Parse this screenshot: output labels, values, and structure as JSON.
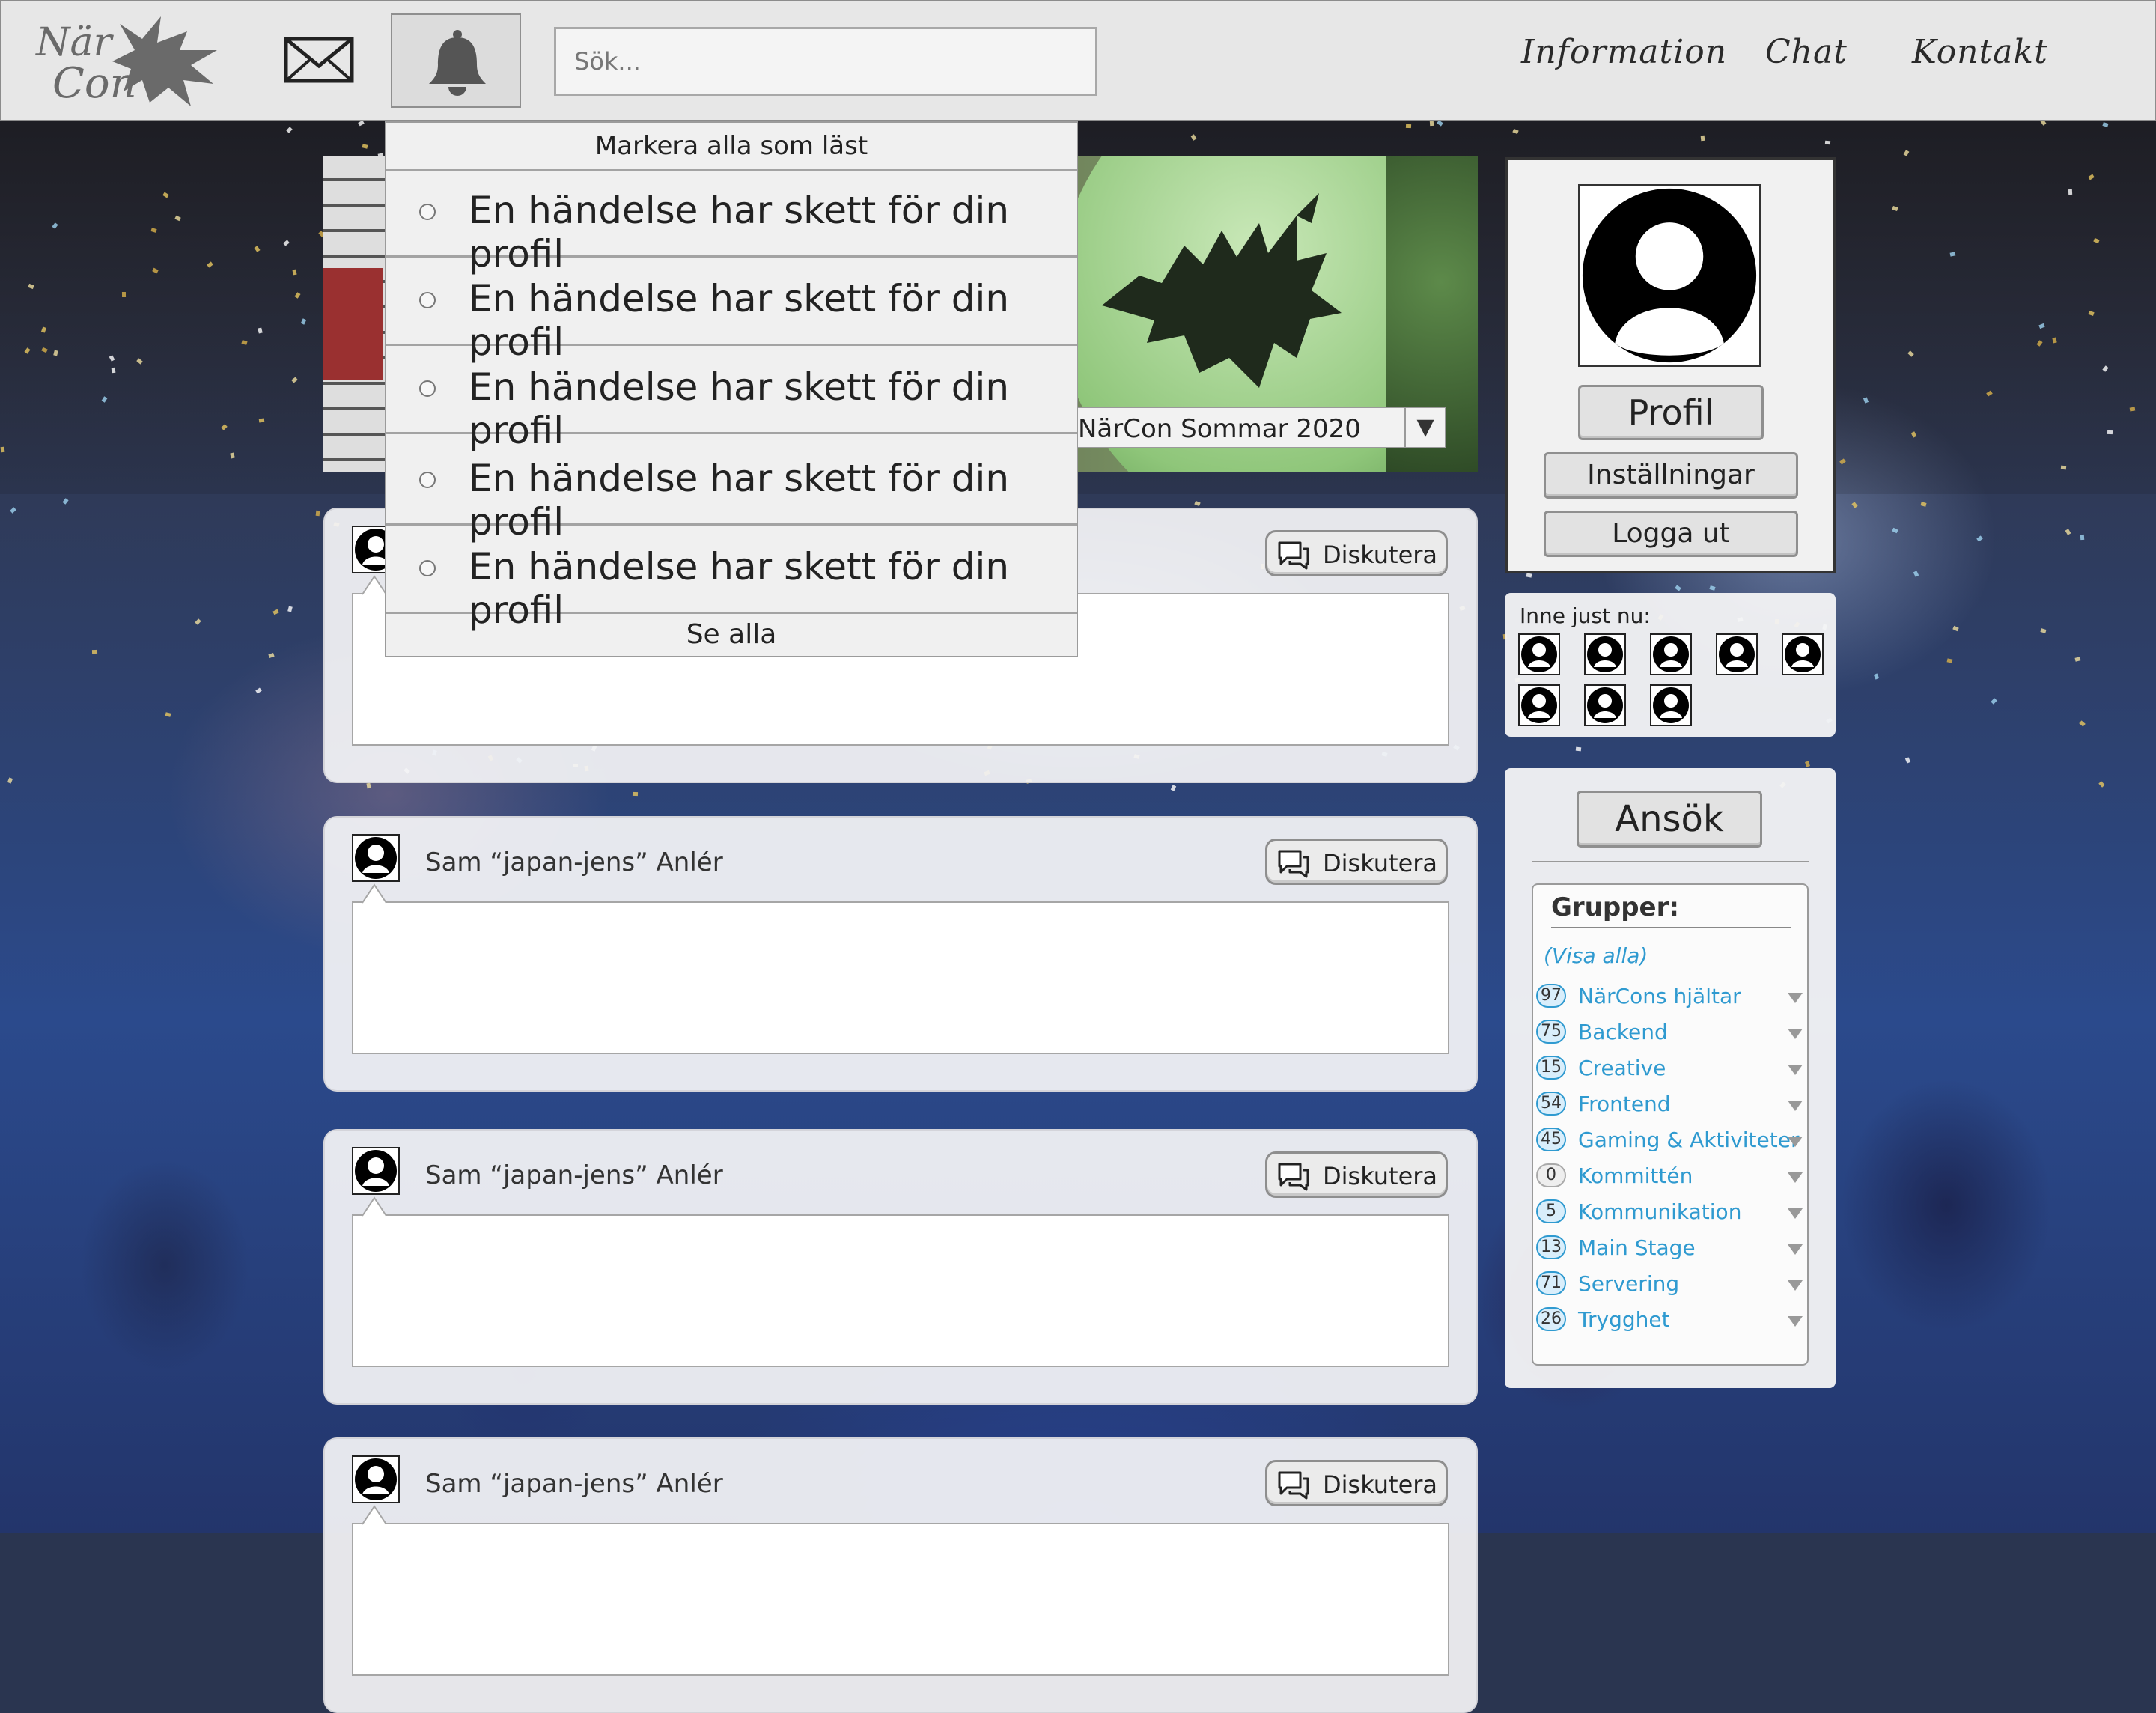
{
  "header": {
    "logo_text": "NärCon",
    "search_placeholder": "Sök...",
    "nav": [
      "Information",
      "Chat",
      "Kontakt"
    ]
  },
  "notifications": {
    "mark_all_label": "Markera alla som läst",
    "items": [
      "En händelse har skett för din profil",
      "En händelse har skett för din profil",
      "En händelse har skett för din profil",
      "En händelse har skett för din profil",
      "En händelse har skett för din profil"
    ],
    "see_all_label": "Se alla"
  },
  "banner": {
    "event_selected": "NärCon Sommar 2020",
    "dropdown_arrow": "▼"
  },
  "posts": [
    {
      "author": "",
      "discuss_label": "Diskutera"
    },
    {
      "author": "Sam “japan-jens” Anlér",
      "discuss_label": "Diskutera"
    },
    {
      "author": "Sam “japan-jens” Anlér",
      "discuss_label": "Diskutera"
    },
    {
      "author": "Sam “japan-jens” Anlér",
      "discuss_label": "Diskutera"
    }
  ],
  "profile": {
    "profile_label": "Profil",
    "settings_label": "Inställningar",
    "logout_label": "Logga ut"
  },
  "online": {
    "title": "Inne just nu:",
    "user_count": 8
  },
  "groups": {
    "apply_label": "Ansök",
    "heading": "Grupper:",
    "view_all_label": "(Visa alla)",
    "items": [
      {
        "count": "97",
        "name": "NärCons hjältar"
      },
      {
        "count": "75",
        "name": "Backend"
      },
      {
        "count": "15",
        "name": "Creative"
      },
      {
        "count": "54",
        "name": "Frontend"
      },
      {
        "count": "45",
        "name": "Gaming & Aktiviteter"
      },
      {
        "count": "0",
        "name": "Kommittén"
      },
      {
        "count": "5",
        "name": "Kommunikation"
      },
      {
        "count": "13",
        "name": "Main Stage"
      },
      {
        "count": "71",
        "name": "Servering"
      },
      {
        "count": "26",
        "name": "Trygghet"
      }
    ]
  },
  "colors": {
    "link_blue": "#2f9ad0",
    "panel_bg": "#f1f1f1",
    "nav_bg": "#e7e7e7"
  }
}
